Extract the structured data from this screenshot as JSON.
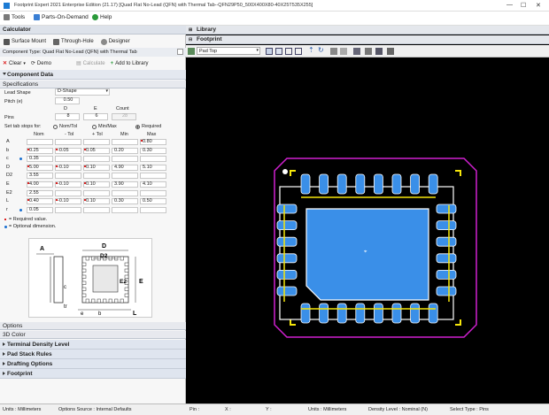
{
  "window": {
    "title": "Footprint Expert 2021 Enterprise Edition (21.17)  [Quad Flat No-Lead (QFN) with Thermal Tab--QFN29P50_500X400X80-40X25T535X255]"
  },
  "menu": {
    "tools": "Tools",
    "parts": "Parts-On-Demand",
    "help": "Help"
  },
  "calculator": {
    "header": "Calculator",
    "surface": "Surface Mount",
    "through": "Through-Hole",
    "designer": "Designer",
    "component_type": "Component Type: Quad Flat No-Lead (QFN) with Thermal Tab",
    "clear": "Clear",
    "demo": "Demo",
    "calculate": "Calculate",
    "add_library": "Add to Library",
    "component_data": "Component Data",
    "specifications": "Specifications",
    "lead_shape_label": "Lead Shape",
    "lead_shape_value": "D-Shape",
    "pitch_label": "Pitch (e)",
    "pitch_value": "0.50",
    "col_D": "D",
    "col_E": "E",
    "col_count": "Count",
    "pins_label": "Pins",
    "pins_D": "8",
    "pins_E": "6",
    "pins_count": "28",
    "tab_label": "Set tab stops for:",
    "opt_nom": "Nom/Tol",
    "opt_minmax": "Min/Max",
    "opt_required": "Required",
    "hdr_nom": "Nom",
    "hdr_mtol": "- Tol",
    "hdr_ptol": "+ Tol",
    "hdr_min": "Min",
    "hdr_max": "Max",
    "rows": [
      {
        "name": "A",
        "nom": "",
        "mtol": "",
        "ptol": "",
        "min": "",
        "max": "0.80"
      },
      {
        "name": "b",
        "nom": "0.25",
        "mtol": "-0.05",
        "ptol": "0.05",
        "min": "0.20",
        "max": "0.30"
      },
      {
        "name": "c",
        "nom": "0.35",
        "mtol": "",
        "ptol": "",
        "min": "",
        "max": ""
      },
      {
        "name": "D",
        "nom": "5.00",
        "mtol": "-0.10",
        "ptol": "0.10",
        "min": "4.90",
        "max": "5.10"
      },
      {
        "name": "D2",
        "nom": "3.55",
        "mtol": "",
        "ptol": "",
        "min": "",
        "max": ""
      },
      {
        "name": "E",
        "nom": "4.00",
        "mtol": "-0.10",
        "ptol": "0.10",
        "min": "3.90",
        "max": "4.10"
      },
      {
        "name": "E2",
        "nom": "2.55",
        "mtol": "",
        "ptol": "",
        "min": "",
        "max": ""
      },
      {
        "name": "L",
        "nom": "0.40",
        "mtol": "-0.10",
        "ptol": "0.10",
        "min": "0.30",
        "max": "0.50"
      },
      {
        "name": "r",
        "nom": "0.05",
        "mtol": "",
        "ptol": "",
        "min": "",
        "max": ""
      }
    ],
    "legend_required": "= Required value.",
    "legend_optional": "= Optional dimension.",
    "diagram": {
      "A": "A",
      "D": "D",
      "D2": "D2",
      "E": "E",
      "E2": "E2",
      "c": "c",
      "tr": "tr",
      "e": "e",
      "b": "b",
      "L": "L"
    },
    "options": "Options",
    "color3d": "3D Color",
    "acc": [
      "Terminal Density Level",
      "Pad Stack Rules",
      "Drafting Options",
      "Footprint"
    ]
  },
  "right": {
    "library": "Library",
    "footprint": "Footprint",
    "view_select": "Pad Top"
  },
  "status": {
    "pin": "Pin :",
    "x": "X :",
    "y": "Y :",
    "units": "Units :  Millimeters",
    "density": "Density Level :  Nominal (N)",
    "select": "Select Type :  Pins",
    "left_units": "Units : Millimeters",
    "options_source": "Options Source :  Internal Defaults"
  },
  "colors": {
    "pad": "#3a8fe8",
    "silk": "#f5e60a",
    "courtyard": "#d020d0",
    "arrow": "#e8701a"
  }
}
